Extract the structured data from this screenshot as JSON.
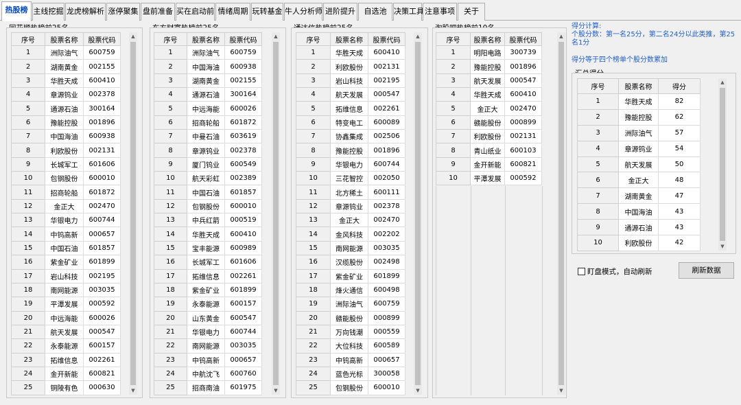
{
  "tabs": [
    {
      "label": "热股榜",
      "active": true
    },
    {
      "label": "主线挖掘"
    },
    {
      "label": "龙虎榜解析"
    },
    {
      "label": "涨停聚集"
    },
    {
      "label": "盘前准备"
    },
    {
      "label": "买在启动前"
    },
    {
      "label": "情绪周期"
    },
    {
      "label": "玩转基金"
    },
    {
      "label": "牛人分析师"
    },
    {
      "label": "进阶提升"
    },
    {
      "label": "自选池"
    },
    {
      "label": "决策工具"
    },
    {
      "label": "注意事项"
    },
    {
      "label": "关于"
    }
  ],
  "headers": {
    "seq": "序号",
    "name": "股票名称",
    "code": "股票代码",
    "score": "得分"
  },
  "lists": [
    {
      "title": "同花顺热榜前25名",
      "rows": [
        [
          "1",
          "洲际油气",
          "600759"
        ],
        [
          "2",
          "湖南黄金",
          "002155"
        ],
        [
          "3",
          "华胜天成",
          "600410"
        ],
        [
          "4",
          "章源钨业",
          "002378"
        ],
        [
          "5",
          "通源石油",
          "300164"
        ],
        [
          "6",
          "豫能控股",
          "001896"
        ],
        [
          "7",
          "中国海油",
          "600938"
        ],
        [
          "8",
          "利欧股份",
          "002131"
        ],
        [
          "9",
          "长城军工",
          "601606"
        ],
        [
          "10",
          "包钢股份",
          "600010"
        ],
        [
          "11",
          "招商轮船",
          "601872"
        ],
        [
          "12",
          "金正大",
          "002470"
        ],
        [
          "13",
          "华银电力",
          "600744"
        ],
        [
          "14",
          "中钨高新",
          "000657"
        ],
        [
          "15",
          "中国石油",
          "601857"
        ],
        [
          "16",
          "紫金矿业",
          "601899"
        ],
        [
          "17",
          "岩山科技",
          "002195"
        ],
        [
          "18",
          "南网能源",
          "003035"
        ],
        [
          "19",
          "平潭发展",
          "000592"
        ],
        [
          "20",
          "中远海能",
          "600026"
        ],
        [
          "21",
          "航天发展",
          "000547"
        ],
        [
          "22",
          "永泰能源",
          "600157"
        ],
        [
          "23",
          "拓维信息",
          "002261"
        ],
        [
          "24",
          "金开新能",
          "600821"
        ],
        [
          "25",
          "铜陵有色",
          "000630"
        ]
      ]
    },
    {
      "title": "东方财富热榜前25名",
      "rows": [
        [
          "1",
          "洲际油气",
          "600759"
        ],
        [
          "2",
          "中国海油",
          "600938"
        ],
        [
          "3",
          "湖南黄金",
          "002155"
        ],
        [
          "4",
          "通源石油",
          "300164"
        ],
        [
          "5",
          "中远海能",
          "600026"
        ],
        [
          "6",
          "招商轮船",
          "601872"
        ],
        [
          "7",
          "中曼石油",
          "603619"
        ],
        [
          "8",
          "章源钨业",
          "002378"
        ],
        [
          "9",
          "厦门钨业",
          "600549"
        ],
        [
          "10",
          "航天彩虹",
          "002389"
        ],
        [
          "11",
          "中国石油",
          "601857"
        ],
        [
          "12",
          "包钢股份",
          "600010"
        ],
        [
          "13",
          "中兵红箭",
          "000519"
        ],
        [
          "14",
          "华胜天成",
          "600410"
        ],
        [
          "15",
          "宝丰能源",
          "600989"
        ],
        [
          "16",
          "长城军工",
          "601606"
        ],
        [
          "17",
          "拓维信息",
          "002261"
        ],
        [
          "18",
          "紫金矿业",
          "601899"
        ],
        [
          "19",
          "永泰能源",
          "600157"
        ],
        [
          "20",
          "山东黄金",
          "600547"
        ],
        [
          "21",
          "华银电力",
          "600744"
        ],
        [
          "22",
          "南网能源",
          "003035"
        ],
        [
          "23",
          "中钨高新",
          "000657"
        ],
        [
          "24",
          "中航沈飞",
          "600760"
        ],
        [
          "25",
          "招商南油",
          "601975"
        ]
      ]
    },
    {
      "title": "通达信热榜前25名",
      "rows": [
        [
          "1",
          "华胜天成",
          "600410"
        ],
        [
          "2",
          "利欧股份",
          "002131"
        ],
        [
          "3",
          "岩山科技",
          "002195"
        ],
        [
          "4",
          "航天发展",
          "000547"
        ],
        [
          "5",
          "拓维信息",
          "002261"
        ],
        [
          "6",
          "特变电工",
          "600089"
        ],
        [
          "7",
          "协鑫集成",
          "002506"
        ],
        [
          "8",
          "豫能控股",
          "001896"
        ],
        [
          "9",
          "华银电力",
          "600744"
        ],
        [
          "10",
          "三花智控",
          "002050"
        ],
        [
          "11",
          "北方稀土",
          "600111"
        ],
        [
          "12",
          "章源钨业",
          "002378"
        ],
        [
          "13",
          "金正大",
          "002470"
        ],
        [
          "14",
          "金风科技",
          "002202"
        ],
        [
          "15",
          "南网能源",
          "003035"
        ],
        [
          "16",
          "汉缆股份",
          "002498"
        ],
        [
          "17",
          "紫金矿业",
          "601899"
        ],
        [
          "18",
          "烽火通信",
          "600498"
        ],
        [
          "19",
          "洲际油气",
          "600759"
        ],
        [
          "20",
          "赣能股份",
          "000899"
        ],
        [
          "21",
          "万向钱潮",
          "000559"
        ],
        [
          "22",
          "大位科技",
          "600589"
        ],
        [
          "23",
          "中钨高新",
          "000657"
        ],
        [
          "24",
          "蓝色光标",
          "300058"
        ],
        [
          "25",
          "包钢股份",
          "600010"
        ]
      ]
    },
    {
      "title": "淘股吧热榜前10名",
      "rows": [
        [
          "1",
          "明阳电路",
          "300739"
        ],
        [
          "2",
          "豫能控股",
          "001896"
        ],
        [
          "3",
          "航天发展",
          "000547"
        ],
        [
          "4",
          "华胜天成",
          "600410"
        ],
        [
          "5",
          "金正大",
          "002470"
        ],
        [
          "6",
          "赣能股份",
          "000899"
        ],
        [
          "7",
          "利欧股份",
          "002131"
        ],
        [
          "8",
          "青山纸业",
          "600103"
        ],
        [
          "9",
          "金开新能",
          "600821"
        ],
        [
          "10",
          "平潭发展",
          "000592"
        ]
      ]
    }
  ],
  "info": {
    "title": "得分计算:",
    "line1": "个股分数：第一名25分，第二名24分以此类推，第25名1分",
    "line2": "得分等于四个榜单个股分数累加"
  },
  "summary": {
    "title": "汇总得分",
    "rows": [
      [
        "1",
        "华胜天成",
        "82"
      ],
      [
        "2",
        "豫能控股",
        "62"
      ],
      [
        "3",
        "洲际油气",
        "57"
      ],
      [
        "4",
        "章源钨业",
        "54"
      ],
      [
        "5",
        "航天发展",
        "50"
      ],
      [
        "6",
        "金正大",
        "48"
      ],
      [
        "7",
        "湖南黄金",
        "47"
      ],
      [
        "8",
        "中国海油",
        "43"
      ],
      [
        "9",
        "通源石油",
        "43"
      ],
      [
        "10",
        "利欧股份",
        "42"
      ]
    ]
  },
  "controls": {
    "auto_refresh_label": "盯盘模式，自动刷新",
    "auto_refresh_checked": false,
    "refresh_button": "刷新数据"
  },
  "colors": {
    "active_tab": "#0046c8",
    "info_text": "#1f5fd0"
  }
}
